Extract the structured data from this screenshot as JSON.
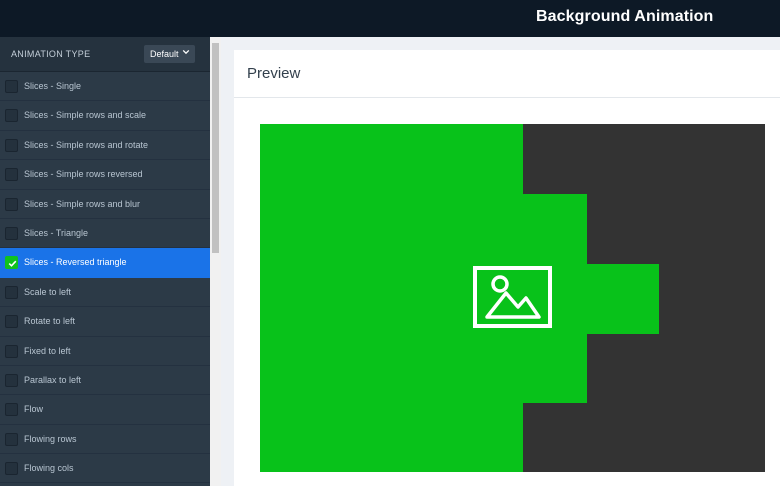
{
  "header": {
    "title": "Background Animation"
  },
  "sidebar": {
    "heading": "ANIMATION TYPE",
    "select_value": "Default",
    "items": [
      {
        "label": "Slices - Single",
        "selected": false
      },
      {
        "label": "Slices - Simple rows and scale",
        "selected": false
      },
      {
        "label": "Slices - Simple rows and rotate",
        "selected": false
      },
      {
        "label": "Slices - Simple rows reversed",
        "selected": false
      },
      {
        "label": "Slices - Simple rows and blur",
        "selected": false
      },
      {
        "label": "Slices - Triangle",
        "selected": false
      },
      {
        "label": "Slices - Reversed triangle",
        "selected": true
      },
      {
        "label": "Scale to left",
        "selected": false
      },
      {
        "label": "Rotate to left",
        "selected": false
      },
      {
        "label": "Fixed to left",
        "selected": false
      },
      {
        "label": "Parallax to left",
        "selected": false
      },
      {
        "label": "Flow",
        "selected": false
      },
      {
        "label": "Flowing rows",
        "selected": false
      },
      {
        "label": "Flowing cols",
        "selected": false
      }
    ]
  },
  "preview": {
    "title": "Preview",
    "icon": "image-icon",
    "colors": {
      "slice": "#08c21a",
      "background": "#333333"
    }
  },
  "colors": {
    "accent": "#1a73e8",
    "check": "#10c21e",
    "topbar": "#0d1926",
    "sidebar": "#2c3a47"
  }
}
